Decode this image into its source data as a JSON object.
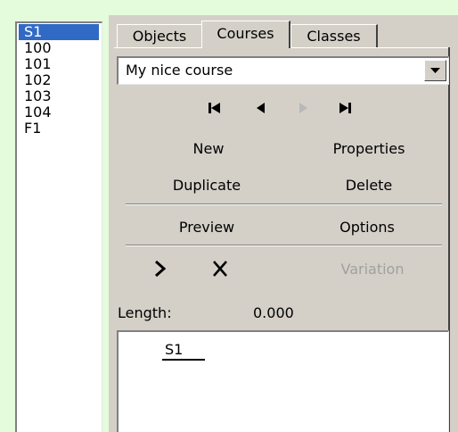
{
  "list": {
    "items": [
      "S1",
      "100",
      "101",
      "102",
      "103",
      "104",
      "F1"
    ],
    "selected_index": 0
  },
  "tabs": [
    "Objects",
    "Courses",
    "Classes"
  ],
  "course_select": {
    "value": "My nice course"
  },
  "nav_icons": [
    "first-icon",
    "previous-icon",
    "next-icon",
    "last-icon"
  ],
  "buttons": {
    "new": "New",
    "properties": "Properties",
    "duplicate": "Duplicate",
    "delete": "Delete",
    "preview": "Preview",
    "options": "Options",
    "variation": "Variation"
  },
  "length": {
    "label": "Length:",
    "value": "0.000"
  },
  "canvas": {
    "control_label": "S1"
  },
  "colors": {
    "selection": "#316ac5",
    "background": "#e4fbdc",
    "panel": "#d4d0c8"
  }
}
